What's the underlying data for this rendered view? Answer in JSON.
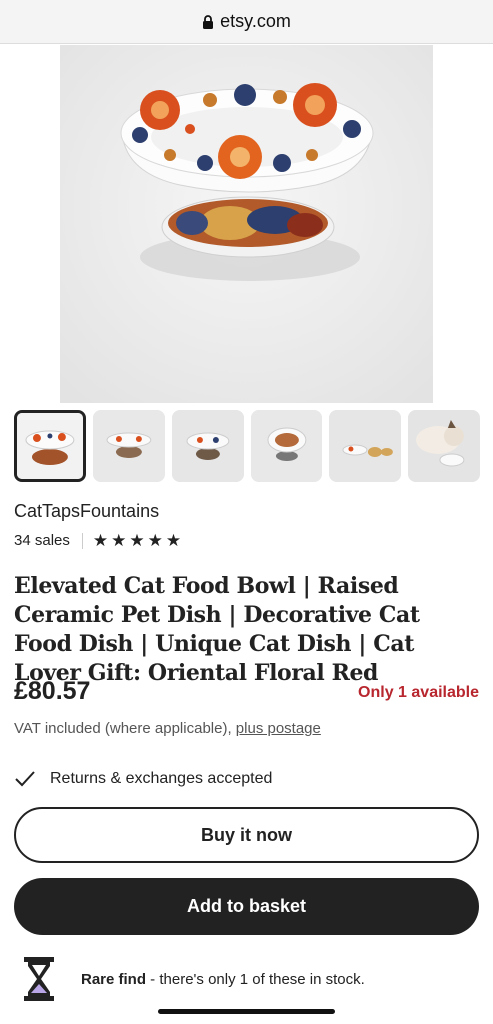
{
  "browser": {
    "url": "etsy.com"
  },
  "gallery": {
    "thumbnails": [
      {
        "label": "bowl-front",
        "active": true
      },
      {
        "label": "bowl-side"
      },
      {
        "label": "bowl-angle"
      },
      {
        "label": "bowl-top"
      },
      {
        "label": "bowls-set"
      },
      {
        "label": "cat-with-bowl"
      }
    ]
  },
  "listing": {
    "shop_name": "CatTapsFountains",
    "sales": "34 sales",
    "rating_stars": 5,
    "title": "Elevated Cat Food Bowl | Raised Ceramic Pet Dish | Decorative Cat Food Dish | Unique Cat Dish | Cat Lover Gift: Oriental Floral Red",
    "price": "£80.57",
    "availability": "Only 1 available",
    "vat_text": "VAT included (where applicable), ",
    "vat_link": "plus postage",
    "returns": "Returns & exchanges accepted"
  },
  "actions": {
    "buy_now": "Buy it now",
    "add_to_basket": "Add to basket"
  },
  "rare_find": {
    "bold": "Rare find",
    "text": " - there's only 1 of these in stock."
  },
  "colors": {
    "accent_red": "#b8262e",
    "button_dark": "#222222"
  }
}
